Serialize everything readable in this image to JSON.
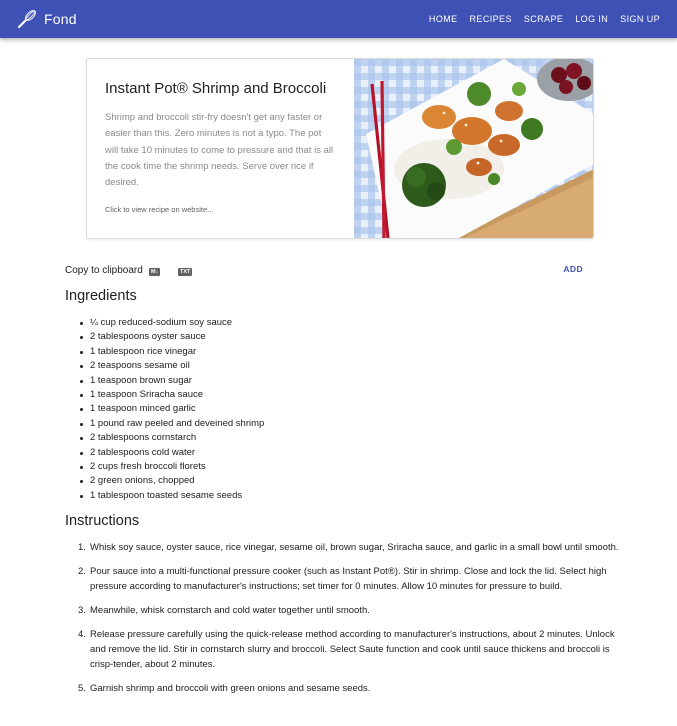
{
  "nav": {
    "brand": "Fond",
    "links": [
      "HOME",
      "RECIPES",
      "SCRAPE",
      "LOG IN",
      "SIGN UP"
    ]
  },
  "recipe": {
    "title": "Instant Pot® Shrimp and Broccoli",
    "description": "Shrimp and broccoli stir-fry doesn't get any faster or easier than this. Zero minutes is not a typo. The pot will take 10 minutes to come to pressure and that is all the cook time the shrimp needs. Serve over rice if desired.",
    "link_text": "Click to view recipe on website..."
  },
  "toolbar": {
    "copy_label": "Copy to clipboard",
    "md_badge": "M↓",
    "txt_badge": "TXT",
    "add_label": "ADD"
  },
  "ingredients": {
    "heading": "Ingredients",
    "items": [
      "¼ cup reduced-sodium soy sauce",
      "2 tablespoons oyster sauce",
      "1 tablespoon rice vinegar",
      "2 teaspoons sesame oil",
      "1 teaspoon brown sugar",
      "1 teaspoon Sriracha sauce",
      "1 teaspoon minced garlic",
      "1 pound raw peeled and deveined shrimp",
      "2 tablespoons cornstarch",
      "2 tablespoons cold water",
      "2 cups fresh broccoli florets",
      "2 green onions, chopped",
      "1 tablespoon toasted sesame seeds"
    ]
  },
  "instructions": {
    "heading": "Instructions",
    "steps": [
      {
        "num": "1.",
        "text": "Whisk soy sauce, oyster sauce, rice vinegar, sesame oil, brown sugar, Sriracha sauce, and garlic in a small bowl until smooth."
      },
      {
        "num": "2.",
        "text": "Pour sauce into a multi-functional pressure cooker (such as Instant Pot®). Stir in shrimp. Close and lock the lid. Select high pressure according to manufacturer's instructions; set timer for 0 minutes. Allow 10 minutes for pressure to build."
      },
      {
        "num": "3.",
        "text": "Meanwhile, whisk cornstarch and cold water together until smooth."
      },
      {
        "num": "4.",
        "text": "Release pressure carefully using the quick-release method according to manufacturer's instructions, about 2 minutes. Unlock and remove the lid. Stir in cornstarch slurry and broccoli. Select Saute function and cook until sauce thickens and broccoli is crisp-tender, about 2 minutes."
      },
      {
        "num": "5.",
        "text": "Garnish shrimp and broccoli with green onions and sesame seeds."
      }
    ]
  },
  "colors": {
    "primary": "#3f51b5",
    "text": "#212121",
    "muted": "#8a8a8a"
  }
}
